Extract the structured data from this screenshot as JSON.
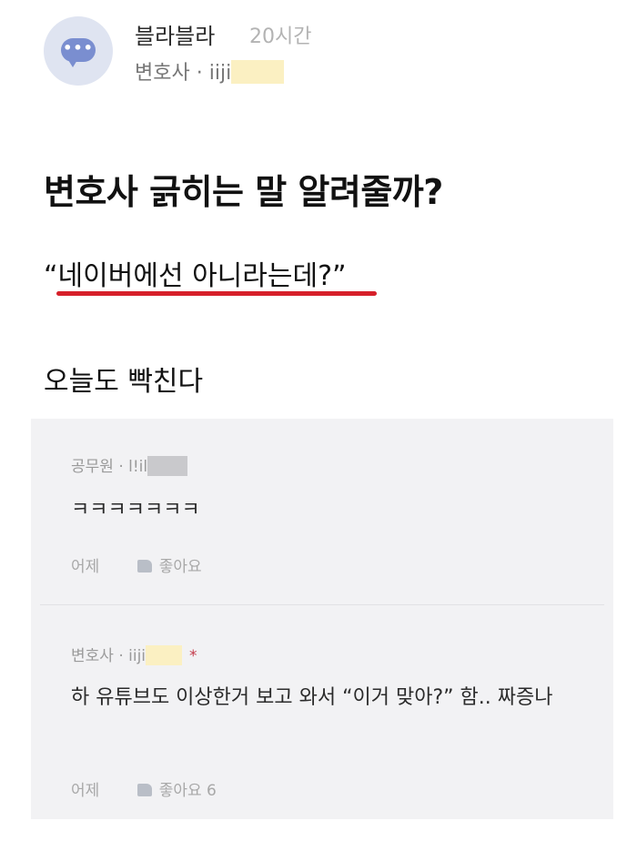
{
  "post": {
    "channel": "블라블라",
    "time": "20시간",
    "author_job": "변호사",
    "author_sep": "·",
    "author_id_prefix": "iiji",
    "title": "변호사 긁히는 말 알려줄까?",
    "quote": "“네이버에선 아니라는데?”",
    "body": "오늘도 빡친다"
  },
  "comments": [
    {
      "job": "공무원",
      "sep": "·",
      "id_prefix": "l!il",
      "text": "ㅋㅋㅋㅋㅋㅋㅋ",
      "time": "어제",
      "like_label": "좋아요",
      "like_count": ""
    },
    {
      "job": "변호사",
      "sep": "·",
      "id_prefix": "iiji",
      "author_mark": "*",
      "text": "하 유튜브도 이상한거 보고 와서 “이거 맞아?” 함.. 짜증나",
      "time": "어제",
      "like_label": "좋아요",
      "like_count": "6"
    }
  ],
  "colors": {
    "accent_underline": "#d6202a",
    "comment_bg": "#f2f2f4",
    "mask_yellow": "#fbf0c2",
    "mask_gray": "#c9c9cc"
  },
  "icons": {
    "avatar": "chat-bubble-icon",
    "like": "thumbs-up-icon"
  }
}
